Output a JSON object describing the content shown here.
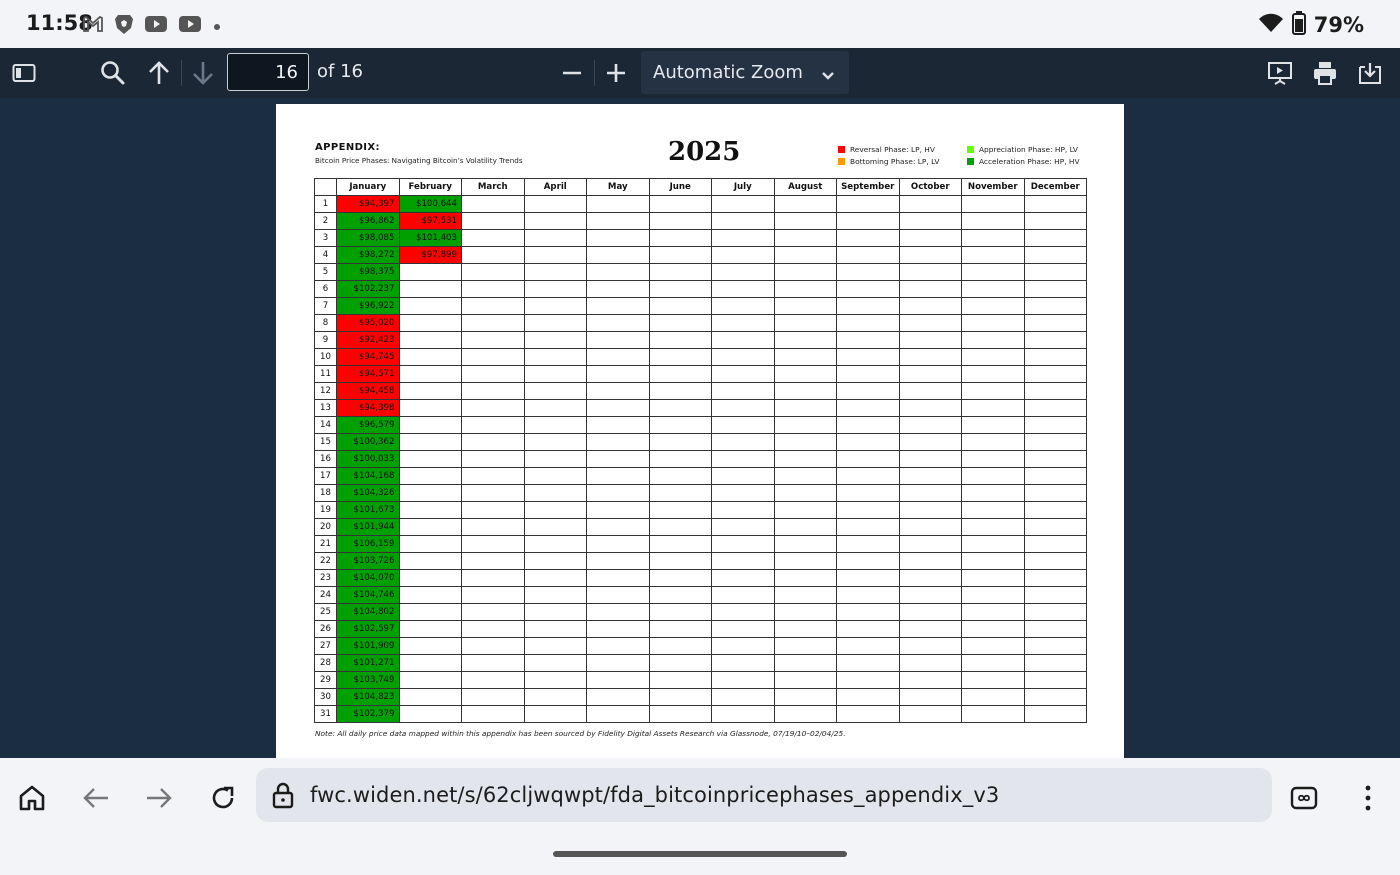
{
  "status_bar": {
    "time": "11:58",
    "battery": "79%",
    "icons_left": [
      "gmail-icon",
      "brave-icon",
      "youtube-icon",
      "youtube-icon",
      "dot-icon"
    ],
    "icons_right": [
      "wifi-icon",
      "battery-icon"
    ]
  },
  "toolbar": {
    "page_number": "16",
    "page_of": "of 16",
    "zoom": "Automatic Zoom"
  },
  "document": {
    "title": "APPENDIX:",
    "subtitle": "Bitcoin Price Phases: Navigating Bitcoin’s Volatility Trends",
    "year": "2025",
    "legend": [
      {
        "label": "Reversal Phase: LP, HV",
        "color": "#ff0000"
      },
      {
        "label": "Bottoming Phase: LP, LV",
        "color": "#ff9900"
      },
      {
        "label": "Appreciation Phase: HP, LV",
        "color": "#66ff00"
      },
      {
        "label": "Acceleration Phase: HP, HV",
        "color": "#00a000"
      }
    ],
    "months": [
      "January",
      "February",
      "March",
      "April",
      "May",
      "June",
      "July",
      "August",
      "September",
      "October",
      "November",
      "December"
    ],
    "days": [
      "1",
      "2",
      "3",
      "4",
      "5",
      "6",
      "7",
      "8",
      "9",
      "10",
      "11",
      "12",
      "13",
      "14",
      "15",
      "16",
      "17",
      "18",
      "19",
      "20",
      "21",
      "22",
      "23",
      "24",
      "25",
      "26",
      "27",
      "28",
      "29",
      "30",
      "31"
    ],
    "january": [
      {
        "v": "$94,397",
        "phase": "red"
      },
      {
        "v": "$96,862",
        "phase": "green"
      },
      {
        "v": "$98,085",
        "phase": "green"
      },
      {
        "v": "$98,272",
        "phase": "green"
      },
      {
        "v": "$98,375",
        "phase": "green"
      },
      {
        "v": "$102,237",
        "phase": "green"
      },
      {
        "v": "$96,922",
        "phase": "green"
      },
      {
        "v": "$95,020",
        "phase": "red"
      },
      {
        "v": "$92,423",
        "phase": "red"
      },
      {
        "v": "$94,745",
        "phase": "red"
      },
      {
        "v": "$94,571",
        "phase": "red"
      },
      {
        "v": "$94,458",
        "phase": "red"
      },
      {
        "v": "$94,398",
        "phase": "red"
      },
      {
        "v": "$96,579",
        "phase": "green"
      },
      {
        "v": "$100,362",
        "phase": "green"
      },
      {
        "v": "$100,033",
        "phase": "green"
      },
      {
        "v": "$104,168",
        "phase": "green"
      },
      {
        "v": "$104,326",
        "phase": "green"
      },
      {
        "v": "$101,673",
        "phase": "green"
      },
      {
        "v": "$101,944",
        "phase": "green"
      },
      {
        "v": "$106,159",
        "phase": "green"
      },
      {
        "v": "$103,726",
        "phase": "green"
      },
      {
        "v": "$104,070",
        "phase": "green"
      },
      {
        "v": "$104,746",
        "phase": "green"
      },
      {
        "v": "$104,802",
        "phase": "green"
      },
      {
        "v": "$102,597",
        "phase": "green"
      },
      {
        "v": "$101,909",
        "phase": "green"
      },
      {
        "v": "$101,271",
        "phase": "green"
      },
      {
        "v": "$103,749",
        "phase": "green"
      },
      {
        "v": "$104,823",
        "phase": "green"
      },
      {
        "v": "$102,379",
        "phase": "green"
      }
    ],
    "february": [
      {
        "v": "$100,644",
        "phase": "green"
      },
      {
        "v": "$97,531",
        "phase": "red"
      },
      {
        "v": "$101,403",
        "phase": "green"
      },
      {
        "v": "$97,899",
        "phase": "red"
      }
    ],
    "phase_colors": {
      "red": "#ff0000",
      "green": "#00a000"
    },
    "note": "Note: All daily price data mapped within this appendix has been sourced by Fidelity Digital Assets Research via Glassnode, 07/19/10–02/04/25."
  },
  "browser": {
    "url": "fwc.widen.net/s/62cljwqwpt/fda_bitcoinpricephases_appendix_v3"
  }
}
